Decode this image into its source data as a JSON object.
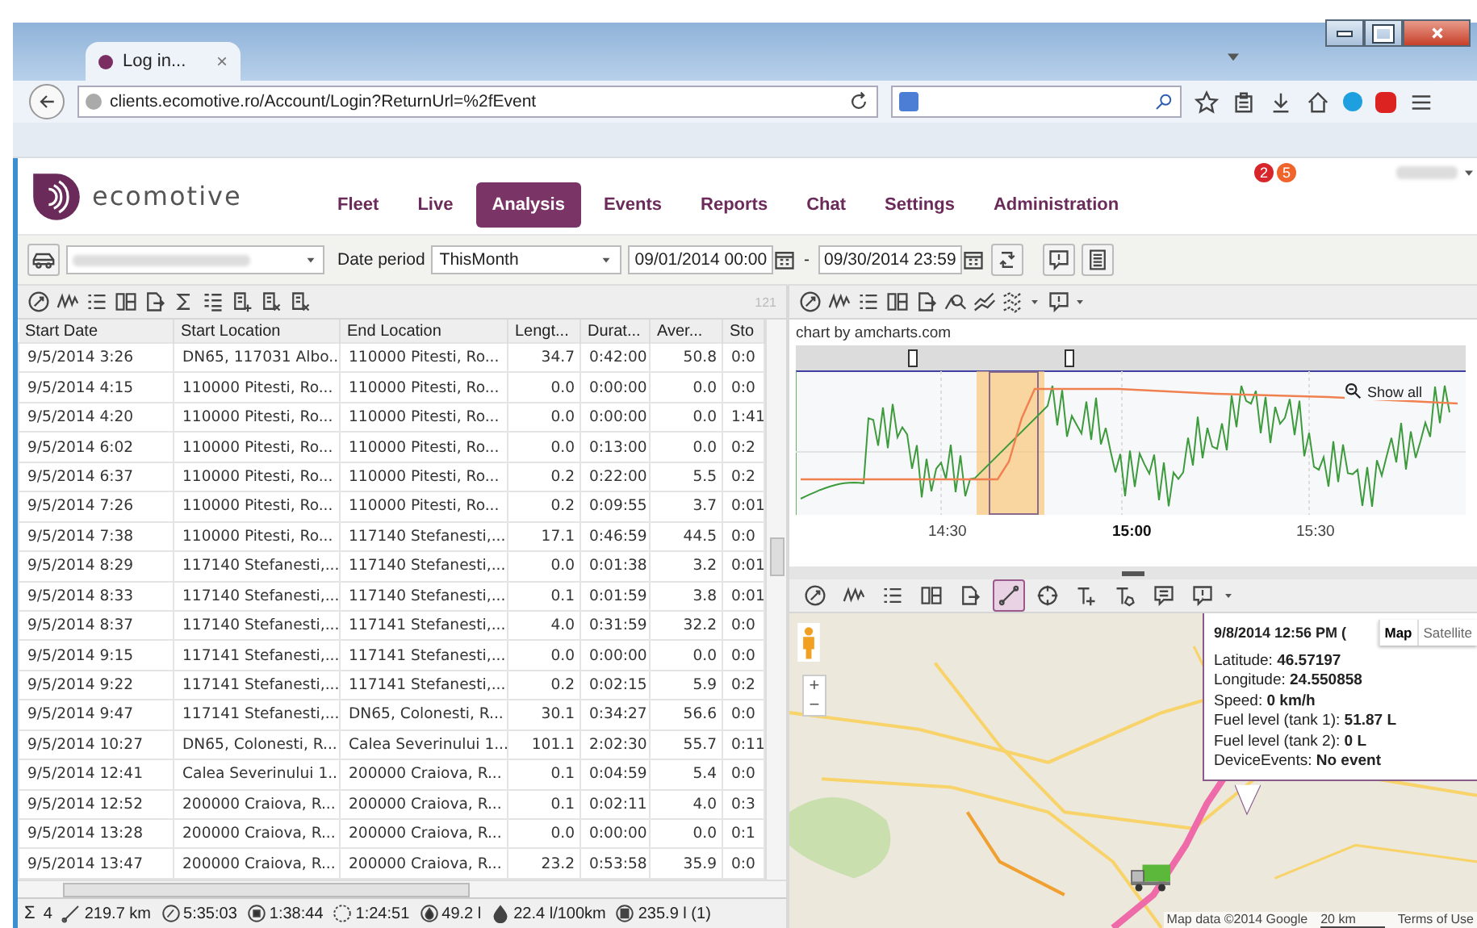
{
  "browser": {
    "tab_title": "Log in...",
    "tab_close": "×",
    "url": "clients.ecomotive.ro/Account/Login?ReturnUrl=%2fEvent"
  },
  "header": {
    "brand": "ecomotive",
    "badges": [
      {
        "count": "2",
        "color": "#d7262b"
      },
      {
        "count": "5",
        "color": "#f0632a"
      }
    ],
    "nav": [
      {
        "label": "Fleet",
        "selected": false
      },
      {
        "label": "Live",
        "selected": false
      },
      {
        "label": "Analysis",
        "selected": true
      },
      {
        "label": "Events",
        "selected": false
      },
      {
        "label": "Reports",
        "selected": false
      },
      {
        "label": "Chat",
        "selected": false
      },
      {
        "label": "Settings",
        "selected": false
      },
      {
        "label": "Administration",
        "selected": false
      }
    ]
  },
  "filter": {
    "date_period_label": "Date period",
    "period": "ThisMonth",
    "from": "09/01/2014 00:00",
    "separator": "-",
    "to": "09/30/2014 23:59"
  },
  "grid": {
    "count": "121",
    "columns": [
      "Start Date",
      "Start Location",
      "End Location",
      "Lengt...",
      "Durat...",
      "Aver...",
      "Sto"
    ],
    "rows": [
      [
        "9/5/2014 3:26",
        "DN65, 117031 Albo...",
        "110000 Pitesti, Ro...",
        "34.7",
        "0:42:00",
        "50.8",
        "0:0"
      ],
      [
        "9/5/2014 4:15",
        "110000 Pitesti, Ro...",
        "110000 Pitesti, Ro...",
        "0.0",
        "0:00:00",
        "0.0",
        "0:0"
      ],
      [
        "9/5/2014 4:20",
        "110000 Pitesti, Ro...",
        "110000 Pitesti, Ro...",
        "0.0",
        "0:00:00",
        "0.0",
        "1:41"
      ],
      [
        "9/5/2014 6:02",
        "110000 Pitesti, Ro...",
        "110000 Pitesti, Ro...",
        "0.0",
        "0:13:00",
        "0.0",
        "0:2"
      ],
      [
        "9/5/2014 6:37",
        "110000 Pitesti, Ro...",
        "110000 Pitesti, Ro...",
        "0.2",
        "0:22:00",
        "5.5",
        "0:2"
      ],
      [
        "9/5/2014 7:26",
        "110000 Pitesti, Ro...",
        "110000 Pitesti, Ro...",
        "0.2",
        "0:09:55",
        "3.7",
        "0:01"
      ],
      [
        "9/5/2014 7:38",
        "110000 Pitesti, Ro...",
        "117140 Stefanesti,...",
        "17.1",
        "0:46:59",
        "44.5",
        "0:0"
      ],
      [
        "9/5/2014 8:29",
        "117140 Stefanesti,...",
        "117140 Stefanesti,...",
        "0.0",
        "0:01:38",
        "3.2",
        "0:01"
      ],
      [
        "9/5/2014 8:33",
        "117140 Stefanesti,...",
        "117140 Stefanesti,...",
        "0.1",
        "0:01:59",
        "3.8",
        "0:01"
      ],
      [
        "9/5/2014 8:37",
        "117140 Stefanesti,...",
        "117141 Stefanesti,...",
        "4.0",
        "0:31:59",
        "32.2",
        "0:0"
      ],
      [
        "9/5/2014 9:15",
        "117141 Stefanesti,...",
        "117141 Stefanesti,...",
        "0.0",
        "0:00:00",
        "0.0",
        "0:0"
      ],
      [
        "9/5/2014 9:22",
        "117141 Stefanesti,...",
        "117141 Stefanesti,...",
        "0.2",
        "0:02:15",
        "5.9",
        "0:2"
      ],
      [
        "9/5/2014 9:47",
        "117141 Stefanesti,...",
        "DN65, Colonesti, R...",
        "30.1",
        "0:34:27",
        "56.6",
        "0:0"
      ],
      [
        "9/5/2014 10:27",
        "DN65, Colonesti, R...",
        "Calea Severinului 1...",
        "101.1",
        "2:02:30",
        "55.7",
        "0:11"
      ],
      [
        "9/5/2014 12:41",
        "Calea Severinului 1...",
        "200000 Craiova, R...",
        "0.1",
        "0:04:59",
        "5.4",
        "0:0"
      ],
      [
        "9/5/2014 12:52",
        "200000 Craiova, R...",
        "200000 Craiova, R...",
        "0.1",
        "0:02:11",
        "4.0",
        "0:3"
      ],
      [
        "9/5/2014 13:28",
        "200000 Craiova, R...",
        "200000 Craiova, R...",
        "0.0",
        "0:00:00",
        "0.0",
        "0:1"
      ],
      [
        "9/5/2014 13:47",
        "200000 Craiova, R...",
        "200000 Craiova, R...",
        "23.2",
        "0:53:58",
        "35.9",
        "0:0"
      ]
    ]
  },
  "totals": [
    {
      "kind": "count",
      "sign": "Σ",
      "text": "4"
    },
    {
      "kind": "distance",
      "text": "219.7 km"
    },
    {
      "kind": "driving",
      "text": "5:35:03"
    },
    {
      "kind": "stopped",
      "text": "1:38:44"
    },
    {
      "kind": "idle",
      "text": "1:24:51"
    },
    {
      "kind": "fuel",
      "text": "49.2 l"
    },
    {
      "kind": "consumption",
      "text": "22.4 l/100km"
    },
    {
      "kind": "tank",
      "text": "235.9 l (1)"
    }
  ],
  "chart": {
    "credit": "chart by amcharts.com",
    "show_all": "Show all",
    "x_labels": [
      {
        "label": "14:30",
        "bold": false
      },
      {
        "label": "15:00",
        "bold": true
      },
      {
        "label": "15:30",
        "bold": false
      }
    ]
  },
  "map": {
    "toolbar": [
      {
        "selected": false
      },
      {
        "selected": false
      },
      {
        "selected": false
      },
      {
        "selected": false
      },
      {
        "selected": false
      },
      {
        "selected": true
      },
      {
        "selected": false
      },
      {
        "selected": false
      },
      {
        "selected": false
      },
      {
        "selected": false
      },
      {
        "selected": false
      }
    ],
    "zoom_in": "+",
    "zoom_out": "−",
    "popup": {
      "title": "9/8/2014 12:56 PM (",
      "lines": [
        "Latitude: **46.57197**",
        "Longitude: **24.550858**",
        "Speed: **0 km/h**",
        "Fuel level (tank 1): **51.87 L**",
        "Fuel level (tank 2): **0 L**",
        "DeviceEvents: **No event**"
      ]
    },
    "map_types": [
      {
        "label": "Map",
        "selected": true
      },
      {
        "label": "Satellite",
        "selected": false
      }
    ],
    "attribution": "Map data ©2014 Google",
    "scale": "20 km",
    "terms": "Terms of Use"
  }
}
